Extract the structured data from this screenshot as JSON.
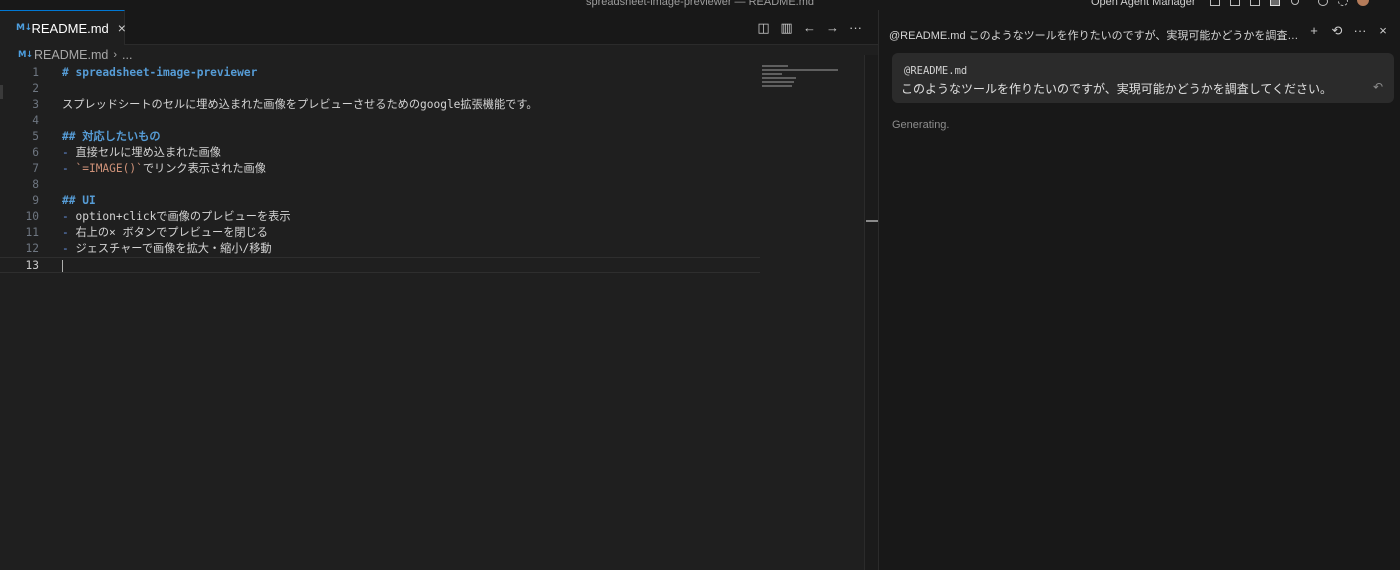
{
  "window": {
    "title": "spreadsheet-image-previewer — README.md",
    "agent_manager_label": "Open Agent Manager"
  },
  "editor": {
    "tab": {
      "icon_label": "M↓",
      "filename": "README.md",
      "close": "×"
    },
    "actions": {
      "split": "◫",
      "layout": "▥",
      "back": "←",
      "forward": "→",
      "more": "···"
    },
    "breadcrumb": {
      "file": "README.md",
      "separator": "›",
      "more": "..."
    },
    "lines": [
      {
        "n": "1",
        "text": "# spreadsheet-image-previewer"
      },
      {
        "n": "2",
        "text": ""
      },
      {
        "n": "3",
        "text": "スプレッドシートのセルに埋め込まれた画像をプレビューさせるためのgoogle拡張機能です。"
      },
      {
        "n": "4",
        "text": ""
      },
      {
        "n": "5",
        "text": "## 対応したいもの"
      },
      {
        "n": "6",
        "bullet": "- ",
        "text": "直接セルに埋め込まれた画像"
      },
      {
        "n": "7",
        "bullet": "- ",
        "code": "`=IMAGE()`",
        "text": "でリンク表示された画像"
      },
      {
        "n": "8",
        "text": ""
      },
      {
        "n": "9",
        "text": "## UI"
      },
      {
        "n": "10",
        "bullet": "- ",
        "text": "option+clickで画像のプレビューを表示"
      },
      {
        "n": "11",
        "bullet": "- ",
        "text": "右上の× ボタンでプレビューを閉じる"
      },
      {
        "n": "12",
        "bullet": "- ",
        "text": "ジェスチャーで画像を拡大・縮小/移動"
      },
      {
        "n": "13",
        "text": ""
      }
    ]
  },
  "agent_panel": {
    "header": "@README.md このようなツールを作りたいのですが、実現可能かどうかを調査してくださ...",
    "actions": {
      "new": "+",
      "history": "⟲",
      "more": "···",
      "close": "×"
    },
    "message": {
      "mention": "@README.md",
      "text": "このようなツールを作りたいのですが、実現可能かどうかを調査してください。",
      "undo": "↶"
    },
    "status": "Generating."
  }
}
